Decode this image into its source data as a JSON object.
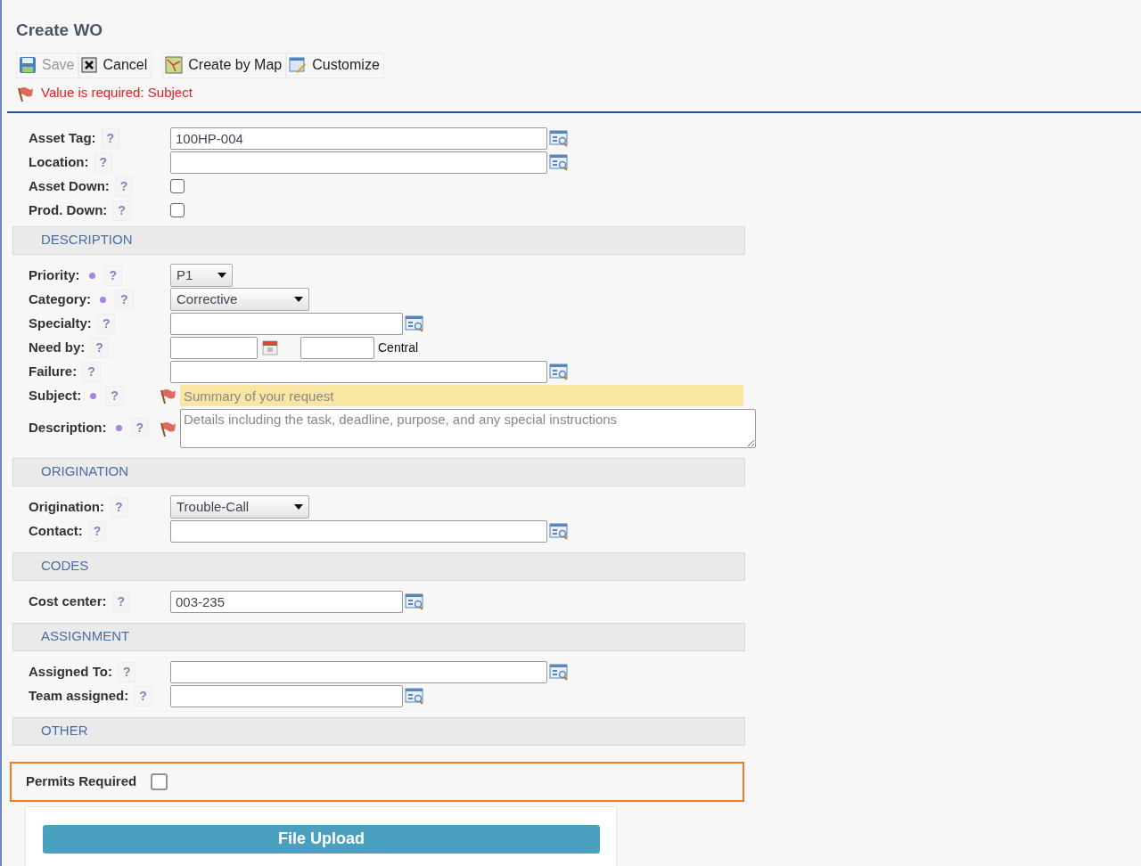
{
  "title": "Create WO",
  "toolbar": [
    {
      "label": "Save",
      "kind": "save",
      "disabled": true
    },
    {
      "label": "Cancel",
      "kind": "cancel",
      "disabled": false
    },
    {
      "label": "Create by Map",
      "kind": "map",
      "disabled": false
    },
    {
      "label": "Customize",
      "kind": "customize",
      "disabled": false
    }
  ],
  "error_message": "Value is required: Subject",
  "sections": [
    {
      "fields": [
        {
          "label": "Asset Tag:",
          "help": "?",
          "kind": "lookup",
          "value": "100HP-004"
        },
        {
          "label": "Location:",
          "help": "?",
          "kind": "lookup"
        },
        {
          "label": "Asset Down:",
          "help": "?",
          "kind": "checkbox",
          "checked": false
        },
        {
          "label": "Prod. Down:",
          "help": "?",
          "kind": "checkbox",
          "checked": false
        }
      ]
    },
    {
      "heading": "DESCRIPTION",
      "fields": [
        {
          "label": "Priority:",
          "help": "?",
          "required": true,
          "kind": "select",
          "value": "P1"
        },
        {
          "label": "Category:",
          "help": "?",
          "required": true,
          "kind": "select",
          "value": "Corrective"
        },
        {
          "label": "Specialty:",
          "help": "?",
          "kind": "lookup_short"
        },
        {
          "label": "Need by:",
          "help": "?",
          "kind": "date",
          "timezone": "Central"
        },
        {
          "label": "Failure:",
          "help": "?",
          "kind": "lookup"
        },
        {
          "label": "Subject:",
          "help": "?",
          "required": true,
          "error": true,
          "highlighted": true,
          "kind": "text",
          "placeholder": "Summary of your request"
        },
        {
          "label": "Description:",
          "help": "?",
          "required": true,
          "error": true,
          "highlighted": false,
          "kind": "textarea",
          "placeholder": "Details including the task, deadline, purpose, and any special instructions"
        }
      ]
    },
    {
      "heading": "ORIGINATION",
      "fields": [
        {
          "label": "Origination:",
          "help": "?",
          "kind": "select",
          "value": "Trouble-Call"
        },
        {
          "label": "Contact:",
          "help": "?",
          "kind": "lookup"
        }
      ]
    },
    {
      "heading": "CODES",
      "fields": [
        {
          "label": "Cost center:",
          "help": "?",
          "kind": "lookup_short",
          "value": "003-235"
        }
      ]
    },
    {
      "heading": "ASSIGNMENT",
      "fields": [
        {
          "label": "Assigned To:",
          "help": "?",
          "kind": "lookup"
        },
        {
          "label": "Team assigned:",
          "help": "?",
          "kind": "lookup_short"
        }
      ]
    },
    {
      "heading": "OTHER"
    }
  ],
  "permits": {
    "label": "Permits Required",
    "checked": false
  },
  "upload_button": "File Upload"
}
